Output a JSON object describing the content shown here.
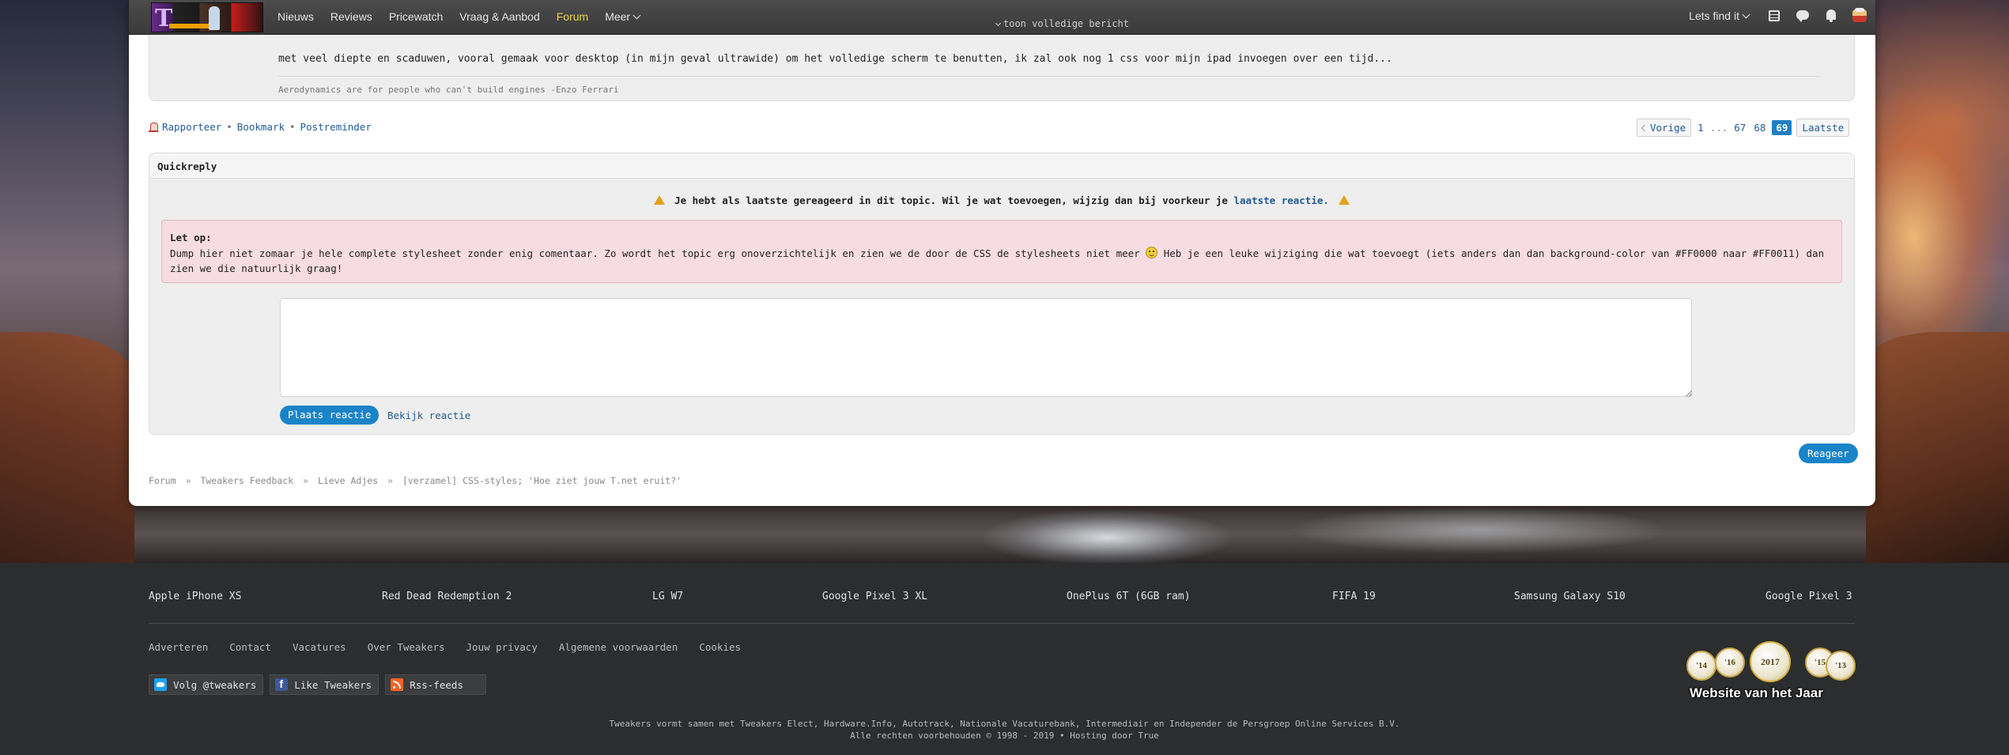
{
  "nav": {
    "items": [
      {
        "label": "Nieuws"
      },
      {
        "label": "Reviews"
      },
      {
        "label": "Pricewatch"
      },
      {
        "label": "Vraag & Aanbod"
      },
      {
        "label": "Forum"
      },
      {
        "label": "Meer"
      }
    ],
    "active": "Forum",
    "toon_meer": "toon volledige bericht",
    "lets_find_it": "Lets find it",
    "icons": [
      "list-icon",
      "chat-icon",
      "bell-icon",
      "avatar-icon"
    ]
  },
  "post": {
    "text": "met veel diepte en scaduwen, vooral gemaak voor desktop (in mijn geval ultrawide) om het volledige scherm te benutten, ik zal ook nog 1 css voor mijn ipad invoegen over een tijd...",
    "signature": "Aerodynamics are for people who can't build engines -Enzo Ferrari"
  },
  "actions": {
    "report": "Rapporteer",
    "bookmark": "Bookmark",
    "postreminder": "Postreminder",
    "separator": "•"
  },
  "pagination": {
    "prev": "Vorige",
    "pages": [
      "1",
      "67",
      "68"
    ],
    "ellipsis": "...",
    "current": "69",
    "last": "Laatste"
  },
  "quickreply": {
    "title": "Quickreply",
    "warning_text": "Je hebt als laatste gereageerd in dit topic. Wil je wat toevoegen, wijzig dan bij voorkeur je",
    "warning_link": "laatste reactie.",
    "notice_title": "Let op:",
    "notice_text_1": "Dump hier niet zomaar je hele complete stylesheet zonder enig comentaar. Zo wordt het topic erg onoverzichtelijk en zien we de door de CSS de stylesheets niet meer",
    "notice_text_2": "Heb je een leuke wijziging die wat toevoegt (iets anders dan dan background-color van #FF0000 naar #FF0011) dan zien we die natuurlijk graag!",
    "textarea_value": "",
    "submit_label": "Plaats reactie",
    "preview_label": "Bekijk reactie"
  },
  "reageer": "Reageer",
  "breadcrumb": {
    "items": [
      "Forum",
      "Tweakers Feedback",
      "Lieve Adjes",
      "[verzamel] CSS-styles; 'Hoe ziet jouw T.net eruit?'"
    ],
    "separator": "»"
  },
  "footer": {
    "trending": [
      "Apple iPhone XS",
      "Red Dead Redemption 2",
      "LG W7",
      "Google Pixel 3 XL",
      "OnePlus 6T (6GB ram)",
      "FIFA 19",
      "Samsung Galaxy S10",
      "Google Pixel 3"
    ],
    "links": [
      "Adverteren",
      "Contact",
      "Vacatures",
      "Over Tweakers",
      "Jouw privacy",
      "Algemene voorwaarden",
      "Cookies"
    ],
    "social": {
      "twitter": "Volg @tweakers",
      "facebook": "Like Tweakers",
      "rss": "Rss-feeds"
    },
    "awards": {
      "years": [
        "'14",
        "'16",
        "2017",
        "'15",
        "'13"
      ],
      "label": "Website van het Jaar"
    },
    "copyright_1": "Tweakers vormt samen met Tweakers Elect, Hardware.Info, Autotrack, Nationale Vacaturebank, Intermediair en Independer de Persgroep Online Services B.V.",
    "copyright_2": "Alle rechten voorbehouden © 1998 - 2019  •  Hosting door True"
  }
}
